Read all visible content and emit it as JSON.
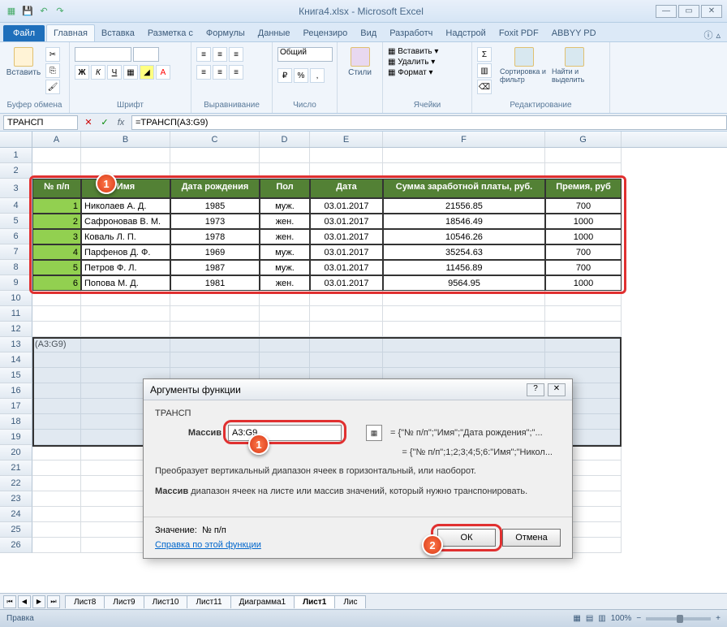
{
  "window": {
    "title": "Книга4.xlsx - Microsoft Excel"
  },
  "ribbon": {
    "file": "Файл",
    "tabs": [
      "Главная",
      "Вставка",
      "Разметка с",
      "Формулы",
      "Данные",
      "Рецензиро",
      "Вид",
      "Разработч",
      "Надстрой",
      "Foxit PDF",
      "ABBYY PD"
    ],
    "active": 0,
    "groups": {
      "clipboard": {
        "label": "Буфер обмена",
        "paste": "Вставить"
      },
      "font": {
        "label": "Шрифт"
      },
      "alignment": {
        "label": "Выравнивание"
      },
      "number": {
        "label": "Число",
        "format": "Общий"
      },
      "styles": {
        "label": "Стили",
        "btn": "Стили"
      },
      "cells": {
        "label": "Ячейки",
        "insert": "Вставить",
        "delete": "Удалить",
        "format": "Формат"
      },
      "editing": {
        "label": "Редактирование",
        "sort": "Сортировка и фильтр",
        "find": "Найти и выделить"
      }
    }
  },
  "formula_bar": {
    "name_box": "ТРАНСП",
    "formula": "=ТРАНСП(A3:G9)"
  },
  "columns": [
    "A",
    "B",
    "C",
    "D",
    "E",
    "F",
    "G"
  ],
  "table": {
    "headers": [
      "№ п/п",
      "Имя",
      "Дата рождения",
      "Пол",
      "Дата",
      "Сумма заработной платы, руб.",
      "Премия, руб"
    ],
    "rows": [
      [
        "1",
        "Николаев А. Д.",
        "1985",
        "муж.",
        "03.01.2017",
        "21556.85",
        "700"
      ],
      [
        "2",
        "Сафроновав В. М.",
        "1973",
        "жен.",
        "03.01.2017",
        "18546.49",
        "1000"
      ],
      [
        "3",
        "Коваль Л. П.",
        "1978",
        "жен.",
        "03.01.2017",
        "10546.26",
        "1000"
      ],
      [
        "4",
        "Парфенов Д. Ф.",
        "1969",
        "муж.",
        "03.01.2017",
        "35254.63",
        "700"
      ],
      [
        "5",
        "Петров Ф. Л.",
        "1987",
        "муж.",
        "03.01.2017",
        "11456.89",
        "700"
      ],
      [
        "6",
        "Попова М. Д.",
        "1981",
        "жен.",
        "03.01.2017",
        "9564.95",
        "1000"
      ]
    ]
  },
  "cell_a13": "(A3:G9)",
  "dialog": {
    "title": "Аргументы функции",
    "func": "ТРАНСП",
    "arg_label": "Массив",
    "arg_value": "A3:G9",
    "arg_preview": "= {\"№ п/п\";\"Имя\";\"Дата рождения\";\"...",
    "result_preview": "= {\"№ п/п\";1;2;3;4;5;6:\"Имя\";\"Никол...",
    "desc": "Преобразует вертикальный диапазон ячеек в горизонтальный, или наоборот.",
    "arg_name": "Массив",
    "arg_desc": "диапазон ячеек на листе или массив значений, который нужно транспонировать.",
    "value_label": "Значение:",
    "value": "№ п/п",
    "help_link": "Справка по этой функции",
    "ok": "ОК",
    "cancel": "Отмена"
  },
  "sheets": [
    "Лист8",
    "Лист9",
    "Лист10",
    "Лист11",
    "Диаграмма1",
    "Лист1",
    "Лис"
  ],
  "active_sheet": 5,
  "status": {
    "mode": "Правка",
    "zoom": "100%"
  },
  "badges": {
    "b1": "1",
    "b2": "2",
    "b1b": "1"
  }
}
